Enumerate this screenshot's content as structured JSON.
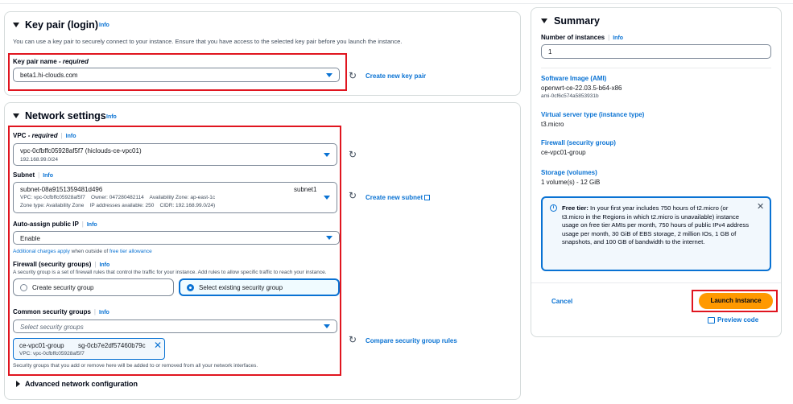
{
  "key_pair": {
    "title": "Key pair (login)",
    "info": "Info",
    "description": "You can use a key pair to securely connect to your instance. Ensure that you have access to the selected key pair before you launch the instance.",
    "name_label": "Key pair name",
    "required": "- required",
    "selected": "beta1.hi-clouds.com",
    "create_link": "Create new key pair"
  },
  "network": {
    "title": "Network settings",
    "info": "Info",
    "vpc_label": "VPC",
    "vpc_required": "- required",
    "vpc_info": "Info",
    "vpc_selected": "vpc-0cfbffc05928af5f7 (hiclouds-ce-vpc01)",
    "vpc_cidr": "192.168.99.0/24",
    "subnet_label": "Subnet",
    "subnet_info": "Info",
    "subnet_id": "subnet-08a9151359481d496",
    "subnet_name": "subnet1",
    "subnet_line1": "VPC: vpc-0cfbffc05928af5f7    Owner: 047280482114    Availability Zone: ap-east-1c",
    "subnet_line2": "Zone type: Availability Zone    IP addresses available: 250    CIDR: 192.168.99.0/24)",
    "create_subnet_link": "Create new subnet",
    "auto_ip_label": "Auto-assign public IP",
    "auto_ip_info": "Info",
    "auto_ip_selected": "Enable",
    "charges_link": "Additional charges apply",
    "charges_mid": " when outside of ",
    "free_tier_link": "free tier allowance",
    "firewall_label": "Firewall (security groups)",
    "firewall_info": "Info",
    "firewall_desc": "A security group is a set of firewall rules that control the traffic for your instance. Add rules to allow specific traffic to reach your instance.",
    "create_sg": "Create security group",
    "select_sg": "Select existing security group",
    "common_sg_label": "Common security groups",
    "common_sg_info": "Info",
    "common_sg_placeholder": "Select security groups",
    "token_name": "ce-vpc01-group",
    "token_id": "sg-0cb7e2df57460b79c",
    "token_vpc": "VPC: vpc-0cfbffc05928af5f7",
    "compare_link": "Compare security group rules",
    "sg_footer": "Security groups that you add or remove here will be added to or removed from all your network interfaces."
  },
  "advanced": {
    "title": "Advanced network configuration"
  },
  "summary": {
    "title": "Summary",
    "instances_label": "Number of instances",
    "instances_info": "Info",
    "instances_value": "1",
    "ami_label": "Software Image (AMI)",
    "ami_value": "openwrt-ce-22.03.5-b64-x86",
    "ami_id": "ami-0cf6c574a5853931b",
    "type_label": "Virtual server type (instance type)",
    "type_value": "t3.micro",
    "firewall_label": "Firewall (security group)",
    "firewall_value": "ce-vpc01-group",
    "storage_label": "Storage (volumes)",
    "storage_value": "1 volume(s) - 12 GiB",
    "free_tier_title": "Free tier:",
    "free_tier_text": "In your first year includes 750 hours of t2.micro (or t3.micro in the Regions in which t2.micro is unavailable) instance usage on free tier AMIs per month, 750 hours of public IPv4 address usage per month, 30 GiB of EBS storage, 2 million IOs, 1 GB of snapshots, and 100 GB of bandwidth to the internet.",
    "cancel": "Cancel",
    "launch": "Launch instance",
    "preview": "Preview code"
  },
  "colors": {
    "accent": "#0972d3",
    "launch": "#ff9900",
    "highlight": "#e0151f",
    "info_bg": "#f2f8fd"
  }
}
